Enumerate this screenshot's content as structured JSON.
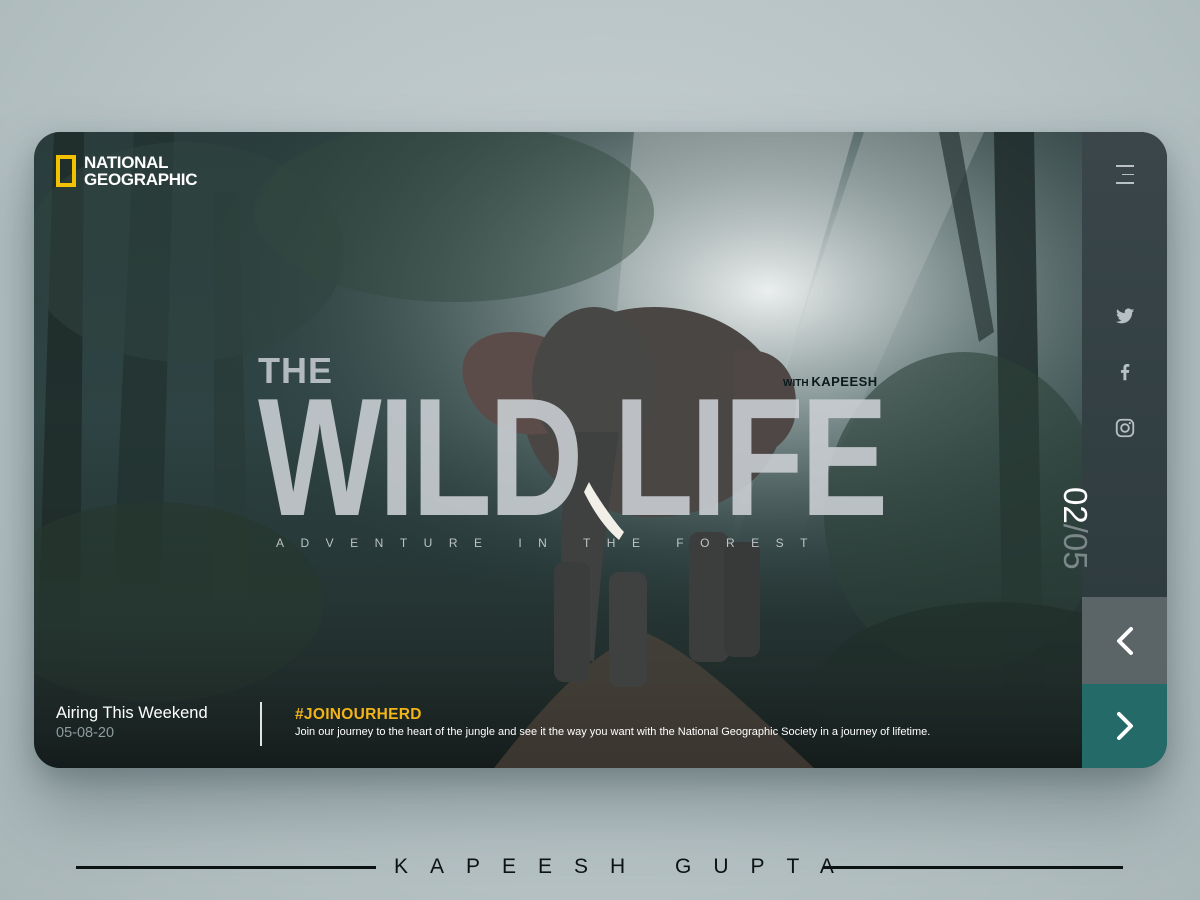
{
  "brand": {
    "line1": "NATIONAL",
    "line2": "GEOGRAPHIC",
    "accent_color": "#f2c200"
  },
  "hero": {
    "title_small": "THE",
    "title_large": "WILD LIFE",
    "with_prefix": "WITH",
    "with_name": "KAPEESH",
    "tagline": "ADVENTURE IN THE FOREST"
  },
  "airing": {
    "title": "Airing This Weekend",
    "date": "05-08-20"
  },
  "cta": {
    "hashtag": "#JOINOURHERD",
    "text": "Join our journey to the heart of the jungle and see it the way you want with the National Geographic Society in a journey of lifetime.",
    "hashtag_color": "#f2b418"
  },
  "sidebar": {
    "menu_icon": "hamburger-menu-icon",
    "social": [
      "twitter-icon",
      "facebook-icon",
      "instagram-icon"
    ],
    "slide_current": "02",
    "slide_separator": "/",
    "slide_total": "05",
    "prev_icon": "chevron-left-icon",
    "next_icon": "chevron-right-icon",
    "next_color": "#246a68"
  },
  "signature": {
    "text": "KAPEESH GUPTA"
  }
}
